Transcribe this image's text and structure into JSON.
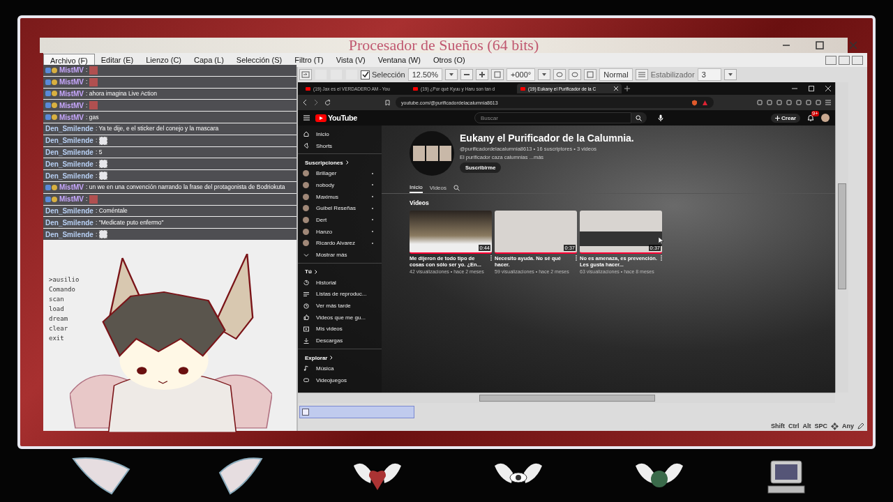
{
  "window": {
    "title": "Procesador de Sueños (64 bits)"
  },
  "menu": [
    {
      "label": "Archivo (F)",
      "selected": true
    },
    {
      "label": "Editar (E)",
      "selected": false
    },
    {
      "label": "Lienzo (C)",
      "selected": false
    },
    {
      "label": "Capa (L)",
      "selected": false
    },
    {
      "label": "Selección (S)",
      "selected": false
    },
    {
      "label": "Filtro (T)",
      "selected": false
    },
    {
      "label": "Vista (V)",
      "selected": false
    },
    {
      "label": "Ventana (W)",
      "selected": false
    },
    {
      "label": "Otros (O)",
      "selected": false
    }
  ],
  "toolbar": {
    "selection": {
      "label": "Selección",
      "checked": true
    },
    "zoom": "12.50%",
    "angle": "+000°",
    "blend": "Normal",
    "stabilizer_label": "Estabilizador",
    "stabilizer": "3"
  },
  "terminal": {
    "lines": [
      ">ausilio",
      "Comando",
      "scan",
      "load",
      "dream",
      "clear",
      "exit"
    ]
  },
  "chat": [
    {
      "user": "MistMV",
      "badges": true,
      "kind": "sticker",
      "text": ":"
    },
    {
      "user": "MistMV",
      "badges": true,
      "kind": "sticker",
      "text": ":"
    },
    {
      "user": "MistMV",
      "badges": true,
      "kind": "text",
      "text": ": ahora imagina Live Action"
    },
    {
      "user": "MistMV",
      "badges": true,
      "kind": "sticker",
      "text": ":"
    },
    {
      "user": "MistMV",
      "badges": true,
      "kind": "text",
      "text": ": gas"
    },
    {
      "user": "Den_Smilende",
      "badges": false,
      "kind": "text",
      "text": ": Ya te dije, e el sticker del conejo y la mascara"
    },
    {
      "user": "Den_Smilende",
      "badges": false,
      "kind": "sticker",
      "text": ":"
    },
    {
      "user": "Den_Smilende",
      "badges": false,
      "kind": "text",
      "text": ": 5"
    },
    {
      "user": "Den_Smilende",
      "badges": false,
      "kind": "sticker",
      "text": ":"
    },
    {
      "user": "Den_Smilende",
      "badges": false,
      "kind": "sticker",
      "text": ":"
    },
    {
      "user": "MistMV",
      "badges": true,
      "kind": "text",
      "text": ": un we en una convención narrando la frase del protagonista de Bodriokuta"
    },
    {
      "user": "MistMV",
      "badges": true,
      "kind": "sticker",
      "text": ":"
    },
    {
      "user": "Den_Smilende",
      "badges": false,
      "kind": "text",
      "text": ": Coméntale"
    },
    {
      "user": "Den_Smilende",
      "badges": false,
      "kind": "text",
      "text": ": \"Medicate puto enfermo\""
    },
    {
      "user": "Den_Smilende",
      "badges": false,
      "kind": "sticker",
      "text": ":"
    }
  ],
  "browser": {
    "tabs": [
      {
        "label": "(19) Jax es el VERDADERO AM - You",
        "selected": false
      },
      {
        "label": "(19) ¿Por qué Kyuu y Haru son tan d",
        "selected": false
      },
      {
        "label": "(19) Eukany el Purificador de la C",
        "selected": true
      }
    ],
    "url": "youtube.com/@purificadordelacalumnia8613"
  },
  "youtube": {
    "logo": "YouTube",
    "search": {
      "placeholder": "Buscar"
    },
    "create": "Crear",
    "notifications": "9+",
    "sidebar": [
      {
        "kind": "item",
        "label": "Inicio"
      },
      {
        "kind": "item",
        "label": "Shorts"
      },
      {
        "kind": "divider"
      },
      {
        "kind": "heading",
        "label": "Suscripciones"
      },
      {
        "kind": "channel",
        "label": "Brillager"
      },
      {
        "kind": "channel",
        "label": "nobody"
      },
      {
        "kind": "channel",
        "label": "Maximus"
      },
      {
        "kind": "channel",
        "label": "Guibel Reseñas"
      },
      {
        "kind": "channel",
        "label": "Dert"
      },
      {
        "kind": "channel",
        "label": "Hanzo"
      },
      {
        "kind": "channel",
        "label": "Ricardo Alvarez"
      },
      {
        "kind": "item",
        "label": "Mostrar más"
      },
      {
        "kind": "divider"
      },
      {
        "kind": "heading",
        "label": "Tú"
      },
      {
        "kind": "item",
        "label": "Historial"
      },
      {
        "kind": "item",
        "label": "Listas de reproduc..."
      },
      {
        "kind": "item",
        "label": "Ver más tarde"
      },
      {
        "kind": "item",
        "label": "Videos que me gu..."
      },
      {
        "kind": "item",
        "label": "Mis videos"
      },
      {
        "kind": "item",
        "label": "Descargas"
      },
      {
        "kind": "divider"
      },
      {
        "kind": "heading",
        "label": "Explorar"
      },
      {
        "kind": "item",
        "label": "Música"
      },
      {
        "kind": "item",
        "label": "Videojuegos"
      }
    ],
    "channel": {
      "name": "Eukany el Purificador de la Calumnia.",
      "meta": "@purificadordelacalumnia8613 • 16 suscriptores • 3 videos",
      "description": "El purificador caza calumnias ...más",
      "subscribe": "Suscribirme",
      "tabs": [
        {
          "label": "Inicio",
          "selected": true
        },
        {
          "label": "Videos",
          "selected": false
        }
      ],
      "section": "Videos",
      "videos": [
        {
          "title": "Me dijeron de todo tipo de cosas con sólo ser yo. ¿En...",
          "duration": "0:44",
          "meta": "42 visualizaciones • hace 2 meses"
        },
        {
          "title": "Necesito ayuda. No sé qué hacer.",
          "duration": "0:37",
          "meta": "59 visualizaciones • hace 2 meses"
        },
        {
          "title": "No es amenaza, es prevención. Les gusta hacer...",
          "duration": "0:37",
          "meta": "63 visualizaciones • hace 8 meses"
        }
      ]
    }
  },
  "status": [
    "Shift",
    "Ctrl",
    "Alt",
    "SPC",
    "Any"
  ]
}
